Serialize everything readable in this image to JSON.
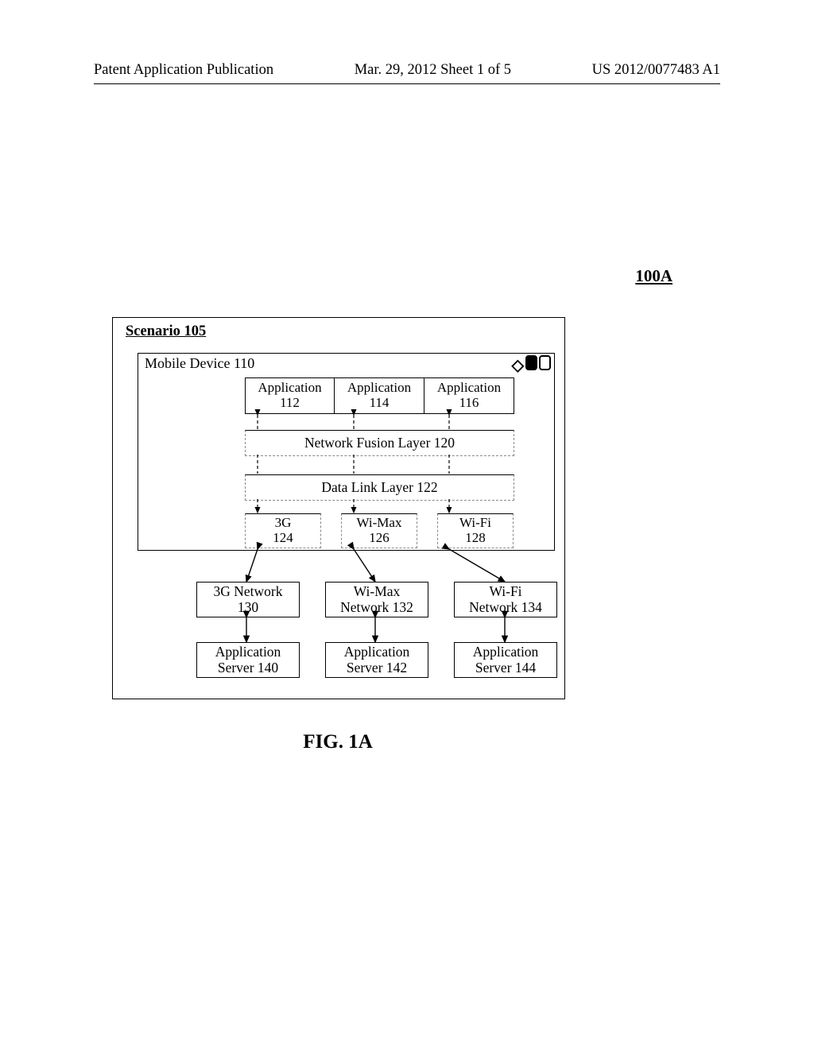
{
  "header": {
    "left": "Patent Application Publication",
    "center": "Mar. 29, 2012  Sheet 1 of 5",
    "right": "US 2012/0077483 A1"
  },
  "figure_ref": "100A",
  "scenario": {
    "title": "Scenario 105",
    "device": {
      "title": "Mobile Device 110",
      "apps": [
        {
          "label": "Application",
          "num": "112"
        },
        {
          "label": "Application",
          "num": "114"
        },
        {
          "label": "Application",
          "num": "116"
        }
      ],
      "layer1": "Network Fusion Layer 120",
      "layer2": "Data Link Layer 122",
      "radios": [
        {
          "label": "3G",
          "num": "124"
        },
        {
          "label": "Wi-Max",
          "num": "126"
        },
        {
          "label": "Wi-Fi",
          "num": "128"
        }
      ]
    },
    "networks": [
      {
        "label": "3G Network",
        "num": "130"
      },
      {
        "label": "Wi-Max",
        "sublabel": "Network 132"
      },
      {
        "label": "Wi-Fi",
        "sublabel": "Network 134"
      }
    ],
    "servers": [
      {
        "label": "Application",
        "sublabel": "Server 140"
      },
      {
        "label": "Application",
        "sublabel": "Server 142"
      },
      {
        "label": "Application",
        "sublabel": "Server 144"
      }
    ]
  },
  "caption": "FIG. 1A",
  "chart_data": {
    "type": "diagram",
    "title": "FIG. 1A — Network Fusion Architecture (100A)",
    "nodes": [
      {
        "id": "scenario105",
        "label": "Scenario 105",
        "type": "container"
      },
      {
        "id": "device110",
        "label": "Mobile Device 110",
        "type": "container",
        "parent": "scenario105"
      },
      {
        "id": "app112",
        "label": "Application 112",
        "parent": "device110"
      },
      {
        "id": "app114",
        "label": "Application 114",
        "parent": "device110"
      },
      {
        "id": "app116",
        "label": "Application 116",
        "parent": "device110"
      },
      {
        "id": "layer120",
        "label": "Network Fusion Layer 120",
        "parent": "device110"
      },
      {
        "id": "layer122",
        "label": "Data Link Layer 122",
        "parent": "device110"
      },
      {
        "id": "r124",
        "label": "3G 124",
        "parent": "device110"
      },
      {
        "id": "r126",
        "label": "Wi-Max 126",
        "parent": "device110"
      },
      {
        "id": "r128",
        "label": "Wi-Fi 128",
        "parent": "device110"
      },
      {
        "id": "net130",
        "label": "3G Network 130",
        "parent": "scenario105"
      },
      {
        "id": "net132",
        "label": "Wi-Max Network 132",
        "parent": "scenario105"
      },
      {
        "id": "net134",
        "label": "Wi-Fi Network 134",
        "parent": "scenario105"
      },
      {
        "id": "srv140",
        "label": "Application Server 140",
        "parent": "scenario105"
      },
      {
        "id": "srv142",
        "label": "Application Server 142",
        "parent": "scenario105"
      },
      {
        "id": "srv144",
        "label": "Application Server 144",
        "parent": "scenario105"
      }
    ],
    "edges": [
      {
        "from": "app112",
        "to": "r124",
        "via": [
          "layer120",
          "layer122"
        ],
        "style": "dashed",
        "bidirectional": true
      },
      {
        "from": "app114",
        "to": "r126",
        "via": [
          "layer120",
          "layer122"
        ],
        "style": "dashed",
        "bidirectional": true
      },
      {
        "from": "app116",
        "to": "r128",
        "via": [
          "layer120",
          "layer122"
        ],
        "style": "dashed",
        "bidirectional": true
      },
      {
        "from": "r124",
        "to": "net130",
        "style": "solid",
        "bidirectional": true
      },
      {
        "from": "r126",
        "to": "net132",
        "style": "solid",
        "bidirectional": true
      },
      {
        "from": "r128",
        "to": "net134",
        "style": "solid",
        "bidirectional": true
      },
      {
        "from": "net130",
        "to": "srv140",
        "style": "solid",
        "bidirectional": true
      },
      {
        "from": "net132",
        "to": "srv142",
        "style": "solid",
        "bidirectional": true
      },
      {
        "from": "net134",
        "to": "srv144",
        "style": "solid",
        "bidirectional": true
      }
    ]
  }
}
